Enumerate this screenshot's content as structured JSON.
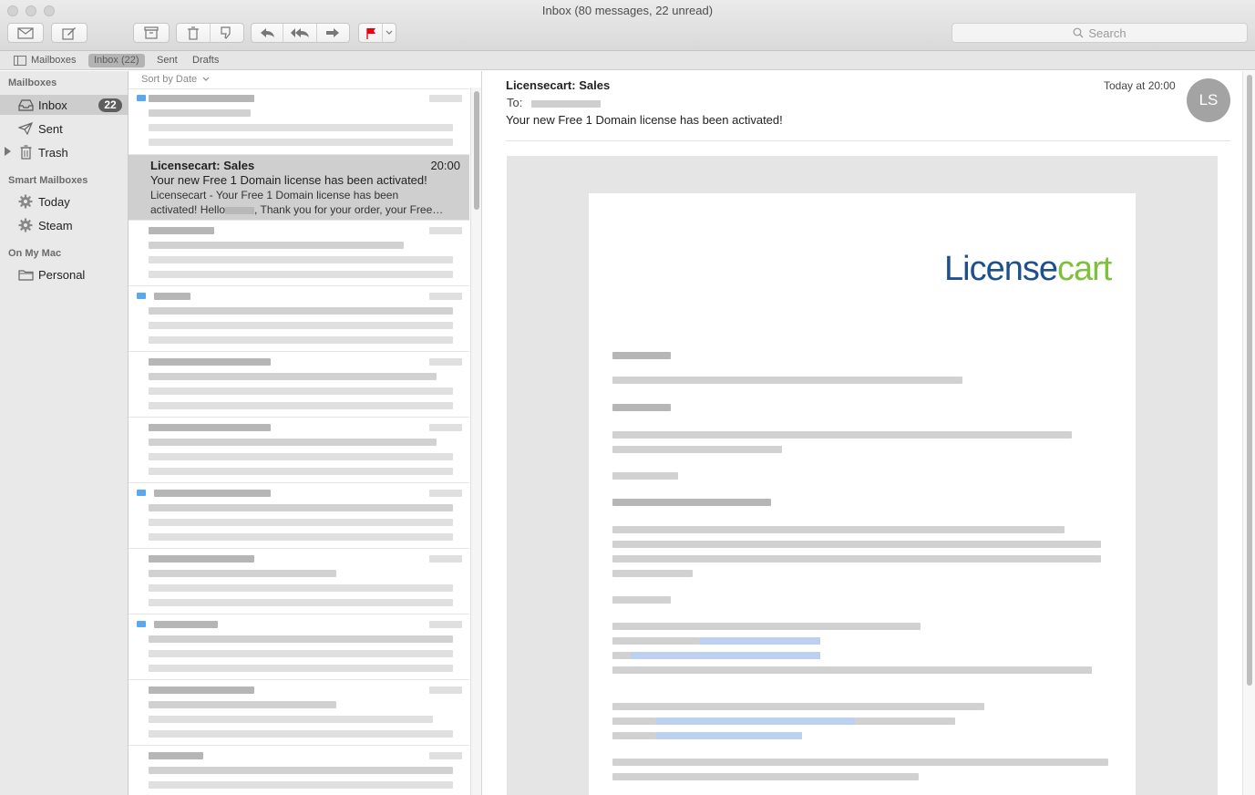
{
  "window": {
    "title": "Inbox (80 messages, 22 unread)"
  },
  "toolbar": {
    "search_placeholder": "Search"
  },
  "favorites": {
    "mailboxes": "Mailboxes",
    "inbox": "Inbox (22)",
    "sent": "Sent",
    "drafts": "Drafts"
  },
  "sidebar": {
    "mailboxes_header": "Mailboxes",
    "smart_header": "Smart Mailboxes",
    "mac_header": "On My Mac",
    "items": {
      "inbox": {
        "label": "Inbox",
        "badge": "22"
      },
      "sent": {
        "label": "Sent"
      },
      "trash": {
        "label": "Trash"
      },
      "today": {
        "label": "Today"
      },
      "steam": {
        "label": "Steam"
      },
      "personal": {
        "label": "Personal"
      }
    }
  },
  "list": {
    "sort_label": "Sort by Date",
    "selected": {
      "from": "Licensecart: Sales",
      "time": "20:00",
      "subject": "Your new Free 1 Domain license has been activated!",
      "preview_line1": "Licensecart - Your Free 1 Domain license has been",
      "preview_line2": "activated! Hello",
      "preview_line2b": ", Thank you for your order, your Free…"
    }
  },
  "message": {
    "from": "Licensecart: Sales",
    "to_label": "To:",
    "subject": "Your new Free 1 Domain license has been activated!",
    "date": "Today at 20:00",
    "avatar_initials": "LS",
    "logo_part1": "License",
    "logo_part2": "cart",
    "logo_colors": {
      "license": "#1e4f8f",
      "cart": "#7fbf3b"
    }
  }
}
